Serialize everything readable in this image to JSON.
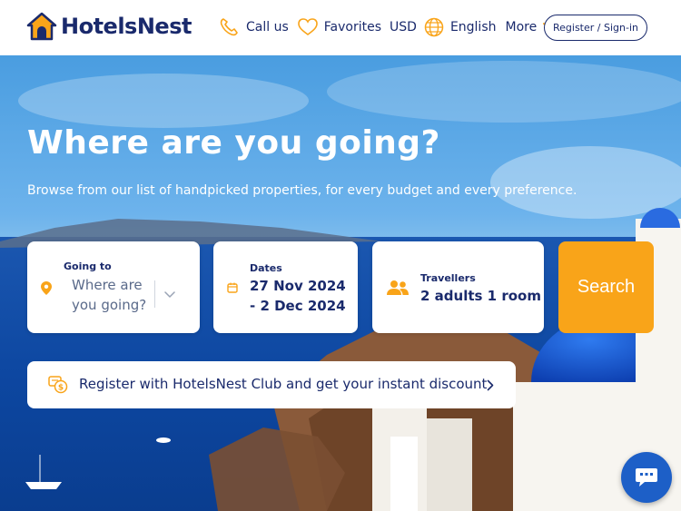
{
  "header": {
    "brand": "HotelsNest",
    "call_label": "Call us",
    "favorites_label": "Favorites",
    "currency": "USD",
    "language": "English",
    "more_label": "More",
    "register_label": "Register / Sign-in"
  },
  "hero": {
    "title": "Where are you going?",
    "subtitle": "Browse from our list of handpicked properties, for every budget and every preference."
  },
  "search": {
    "going_to_label": "Going to",
    "going_to_placeholder_line1": "Where are",
    "going_to_placeholder_line2": "you going?",
    "dates_label": "Dates",
    "dates_line1": "27 Nov 2024",
    "dates_line2": "- 2 Dec 2024",
    "travellers_label": "Travellers",
    "travellers_value": "2 adults 1 room",
    "search_label": "Search"
  },
  "club": {
    "text": "Register with HotelsNest Club and get your instant discount"
  },
  "colors": {
    "brand_navy": "#1a2a6c",
    "accent_orange": "#f9a419",
    "chat_blue": "#1d5fc7"
  },
  "icons": [
    "house-logo-icon",
    "phone-icon",
    "heart-icon",
    "globe-icon",
    "chevron-down-icon",
    "location-pin-icon",
    "calendar-icon",
    "people-icon",
    "coins-icon",
    "chevron-right-icon",
    "chat-icon"
  ]
}
